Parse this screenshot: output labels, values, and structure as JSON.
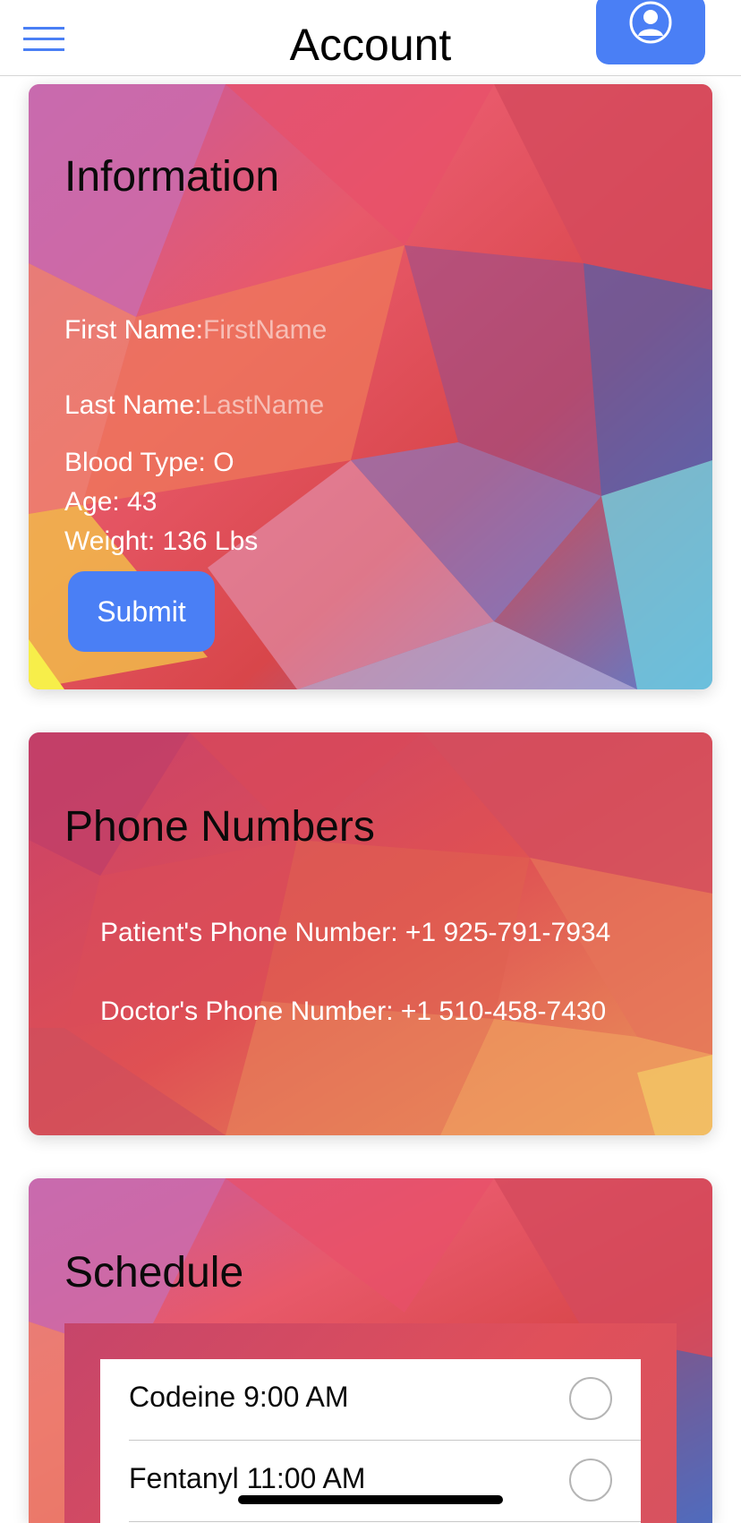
{
  "header": {
    "title": "Account",
    "menu_icon": "hamburger-menu-icon",
    "profile_icon": "user-profile-icon",
    "accent_color": "#4a7ff5"
  },
  "information": {
    "title": "Information",
    "first_name_label": "First Name:",
    "first_name_placeholder": "FirstName",
    "first_name_value": "",
    "last_name_label": "Last Name:",
    "last_name_placeholder": "LastName",
    "last_name_value": "",
    "blood_type": "Blood Type: O",
    "age": "Age: 43",
    "weight": "Weight: 136 Lbs",
    "submit_label": "Submit"
  },
  "phone_numbers": {
    "title": "Phone Numbers",
    "patient_phone": "Patient's Phone Number: +1 925-791-7934",
    "doctor_phone": "Doctor's Phone Number: +1 510-458-7430"
  },
  "schedule": {
    "title": "Schedule",
    "items": [
      {
        "label": "Codeine 9:00 AM",
        "checked": false
      },
      {
        "label": "Fentanyl 11:00 AM",
        "checked": false
      }
    ]
  }
}
